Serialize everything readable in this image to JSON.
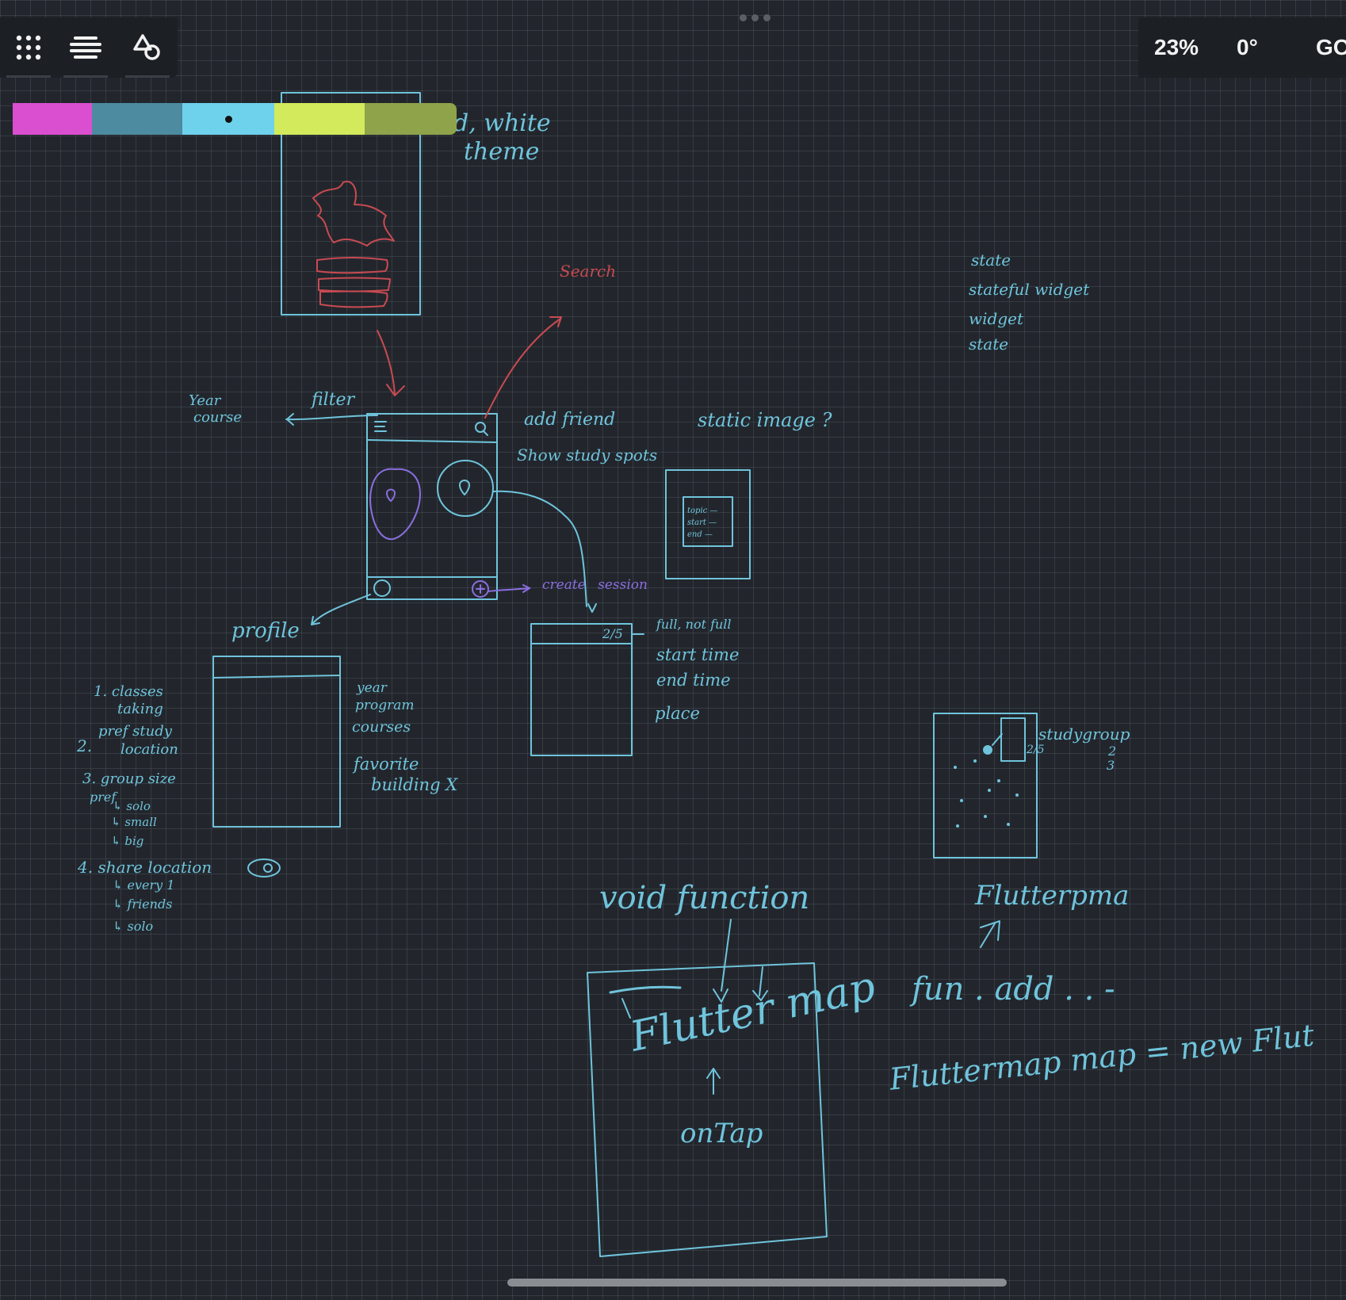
{
  "toolbar": {
    "left_buttons": [
      {
        "name": "apps-grid-icon"
      },
      {
        "name": "layers-menu-icon"
      },
      {
        "name": "shapes-tool-icon"
      }
    ],
    "zoom": "23%",
    "rotation": "0°",
    "go_label": "GO"
  },
  "palette": {
    "colors": [
      "#d94fd0",
      "#4d8ba0",
      "#6fd2ec",
      "#d3ea5c",
      "#8fa34a"
    ],
    "selected_index": 2
  },
  "notes": {
    "theme_partial": "d, white",
    "theme": "theme",
    "search": "Search",
    "filter": "filter",
    "year": "Year",
    "course": "course",
    "add_friend": "add friend",
    "show_study_spots": "Show study spots",
    "static_image": "static image ?",
    "card_topic": "topic —",
    "card_start": "start —",
    "card_end": "end —",
    "create_session": "create session",
    "profile": "profile",
    "session_count": "2/5",
    "full_not_full": "full, not full",
    "start_time": "start time",
    "end_time": "end time",
    "place": "place",
    "prof_year": "year",
    "prof_program": "program",
    "prof_courses": "courses",
    "prof_favorite": "favorite",
    "prof_building": "building X",
    "list_1": "1.  classes",
    "list_1b": "taking",
    "list_2": "pref  study",
    "list_2num": "2.",
    "list_2b": "location",
    "list_3": "3. group  size",
    "list_3b": "pref",
    "list_3_solo": "↳ solo",
    "list_3_small": "↳ small",
    "list_3_big": "↳ big",
    "list_4": "4. share  location",
    "list_4_every": "↳ every 1",
    "list_4_friends": "↳ friends",
    "list_4_solo": "↳ solo",
    "state1": "state",
    "stateful_widget": "stateful widget",
    "widget": "widget",
    "state2": "state",
    "study_group": "studygroup",
    "count_25": "2/5",
    "count_23": "2",
    "count_23b": "3",
    "void_function": "void function",
    "flutter_map": "Flutter map",
    "ontap": "onTap",
    "flutterpm": "Flutterpma",
    "fun_add": "fun . add . . -",
    "fluttermap_line": "Fluttermap map = new Flut"
  }
}
